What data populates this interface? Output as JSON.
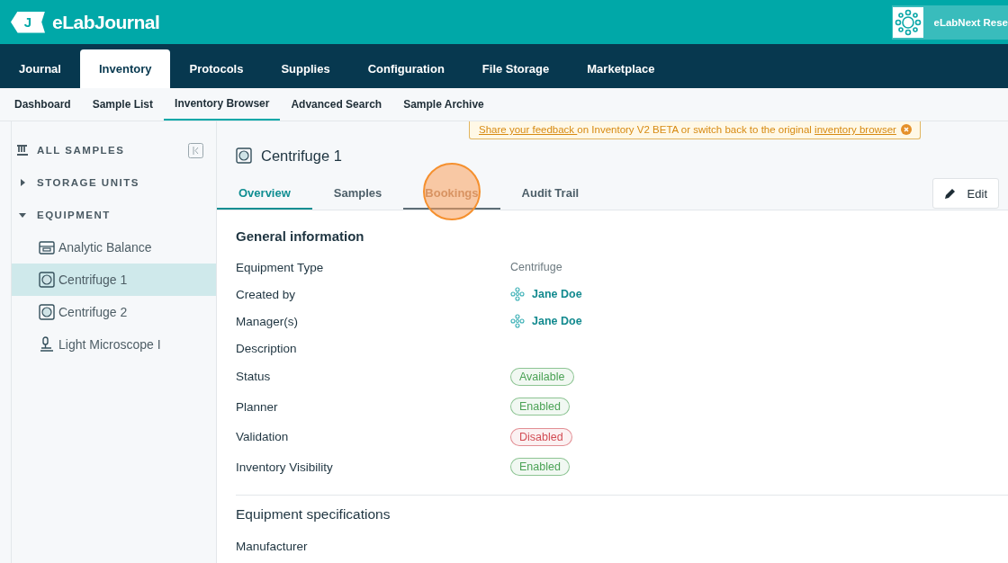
{
  "header": {
    "logo_mark": "J",
    "app_name": "eLabJournal",
    "organization": "eLabNext Rese"
  },
  "main_nav": [
    {
      "label": "Journal",
      "selected": false
    },
    {
      "label": "Inventory",
      "selected": true
    },
    {
      "label": "Protocols",
      "selected": false
    },
    {
      "label": "Supplies",
      "selected": false
    },
    {
      "label": "Configuration",
      "selected": false
    },
    {
      "label": "File Storage",
      "selected": false
    },
    {
      "label": "Marketplace",
      "selected": false
    }
  ],
  "sub_nav": [
    {
      "label": "Dashboard",
      "selected": false
    },
    {
      "label": "Sample List",
      "selected": false
    },
    {
      "label": "Inventory Browser",
      "selected": true
    },
    {
      "label": "Advanced Search",
      "selected": false
    },
    {
      "label": "Sample Archive",
      "selected": false
    }
  ],
  "sidebar": {
    "sections": [
      {
        "label": "ALL SAMPLES",
        "kind": "all"
      },
      {
        "label": "STORAGE UNITS",
        "kind": "group",
        "expanded": false
      },
      {
        "label": "EQUIPMENT",
        "kind": "group",
        "expanded": true,
        "children": [
          {
            "label": "Analytic Balance",
            "kind": "balance",
            "selected": false
          },
          {
            "label": "Centrifuge 1",
            "kind": "centrifuge",
            "selected": true
          },
          {
            "label": "Centrifuge 2",
            "kind": "centrifuge",
            "selected": false
          },
          {
            "label": "Light Microscope I",
            "kind": "microscope",
            "selected": false
          }
        ]
      }
    ]
  },
  "banner": {
    "link": "Share your feedback ",
    "text": "on Inventory V2 BETA or switch back to the original ",
    "link_2": "inventory browser"
  },
  "item": {
    "title": "Centrifuge 1",
    "edit_button": "Edit"
  },
  "tabs": [
    {
      "label": "Overview",
      "selected": true,
      "highlighted": false
    },
    {
      "label": "Samples",
      "selected": false,
      "highlighted": false
    },
    {
      "label": "Bookings",
      "selected": false,
      "highlighted": true
    },
    {
      "label": "Audit Trail",
      "selected": false,
      "highlighted": false
    }
  ],
  "sections": [
    {
      "title": "General information",
      "fields": [
        {
          "label": "Equipment Type",
          "kind": "text",
          "value": "Centrifuge"
        },
        {
          "label": "Created by",
          "kind": "user",
          "value": "Jane Doe"
        },
        {
          "label": "Manager(s)",
          "kind": "user",
          "value": "Jane Doe"
        },
        {
          "label": "Description",
          "kind": "empty"
        },
        {
          "label": "Status",
          "kind": "badge",
          "color": "#4ba255",
          "value": "Available"
        },
        {
          "label": "Planner",
          "kind": "badge",
          "color": "#4ba255",
          "value": "Enabled"
        },
        {
          "label": "Validation",
          "kind": "badge",
          "color": "#d24d55",
          "value": "Disabled"
        },
        {
          "label": "Inventory Visibility",
          "kind": "badge",
          "color": "#4ba255",
          "value": "Enabled"
        }
      ]
    },
    {
      "title": "Equipment specifications",
      "fields": [
        {
          "label": "Manufacturer",
          "kind": "empty"
        }
      ]
    }
  ]
}
